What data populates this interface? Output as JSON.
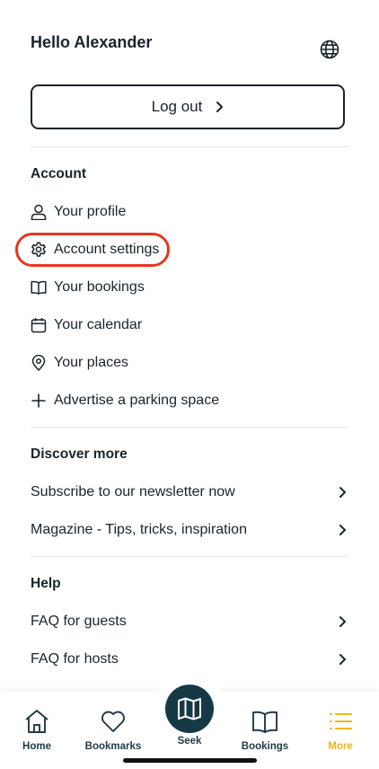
{
  "header": {
    "greeting": "Hello Alexander",
    "globe_icon": "globe-icon"
  },
  "logout": {
    "label": "Log out",
    "icon": "chevron-right-icon"
  },
  "account": {
    "title": "Account",
    "items": [
      {
        "label": "Your profile",
        "icon": "user-icon"
      },
      {
        "label": "Account settings",
        "icon": "gear-icon"
      },
      {
        "label": "Your bookings",
        "icon": "book-icon"
      },
      {
        "label": "Your calendar",
        "icon": "calendar-icon"
      },
      {
        "label": "Your places",
        "icon": "location-pin-icon"
      },
      {
        "label": "Advertise a parking space",
        "icon": "plus-icon"
      }
    ]
  },
  "discover": {
    "title": "Discover more",
    "items": [
      {
        "label": "Subscribe to our newsletter now"
      },
      {
        "label": "Magazine - Tips, tricks, inspiration"
      }
    ]
  },
  "help": {
    "title": "Help",
    "items": [
      {
        "label": "FAQ for guests"
      },
      {
        "label": "FAQ for hosts"
      }
    ]
  },
  "tabbar": {
    "tabs": [
      {
        "label": "Home",
        "icon": "home-icon"
      },
      {
        "label": "Bookmarks",
        "icon": "heart-icon"
      },
      {
        "label": "Seek",
        "icon": "map-icon"
      },
      {
        "label": "Bookings",
        "icon": "book-icon"
      },
      {
        "label": "More",
        "icon": "menu-list-icon",
        "active": true
      }
    ],
    "active_color": "#f0b51a",
    "seek_color": "#163a45"
  },
  "annotation": {
    "highlight_color": "#e8351e"
  }
}
